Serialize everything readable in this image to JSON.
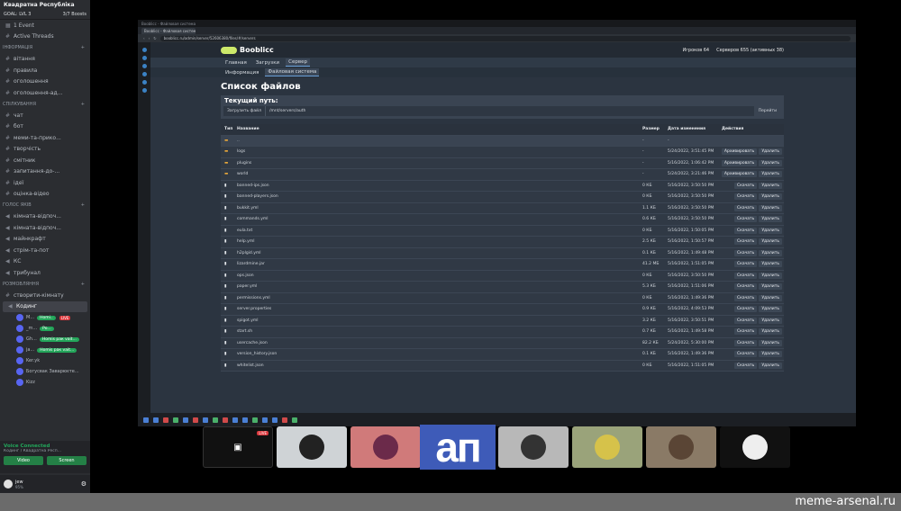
{
  "discord": {
    "server_name": "Квадратна Республіка",
    "goal": "GOAL: LVL 3",
    "boosts": "3/7 Boosts",
    "events": "1 Event",
    "active_threads": "Active Threads",
    "categories": [
      {
        "name": "ІНФОРМАЦІЯ",
        "channels": [
          "вітання",
          "правила",
          "оголошення",
          "оголошення-ад..."
        ]
      },
      {
        "name": "СПІЛКУВАННЯ",
        "channels": [
          "чат",
          "бот",
          "меми-та-прико...",
          "творчість",
          "смітник",
          "запитання-до-...",
          "ідеї",
          "оцінка-відео"
        ]
      },
      {
        "name": "ГОЛОС ЯКІВ",
        "channels": [
          "кімната-відпоч...",
          "кімната-відпоч...",
          "майнкрафт",
          "стрім-та-пот",
          "КС",
          "трибунал"
        ]
      },
      {
        "name": "РОЗМОВЛЯННЯ",
        "channels": [
          "створити-кімнату"
        ]
      }
    ],
    "active_voice": "Кодинг",
    "voice_users": [
      {
        "name": "M...",
        "badge": "Homi..",
        "live": "LIVE"
      },
      {
        "name": "_m...",
        "badge": "Po..."
      },
      {
        "name": "Gh...",
        "badge": "Homis рак vait..."
      },
      {
        "name": "ja...",
        "badge": "Homis рак vait..."
      },
      {
        "name": "Ker.yk"
      },
      {
        "name": "Богусвак Заварюєте..."
      },
      {
        "name": "Kizz"
      }
    ],
    "voice_connected": "Voice Connected",
    "voice_sub": "Кодинг / Квадратна Респ...",
    "video_btn": "Video",
    "screen_btn": "Screen",
    "user_name": "jew",
    "user_status": "95%"
  },
  "browser": {
    "tab_title": "Booblicc - Файловая система",
    "url": "booblicc.ru/admin/server/52606380/files/#/servers"
  },
  "panel": {
    "logo": "Booblicc",
    "players": "Игроков 64",
    "servers": "Серверов 655 (активных 38)",
    "nav1": [
      "Главная",
      "Загрузки",
      "Сервер"
    ],
    "nav2": [
      "Информация",
      "Файловая система"
    ],
    "title": "Список файлов",
    "current_path_label": "Текущий путь:",
    "upload": "Загрузить файл",
    "path": "/mnt/servers/auth",
    "go": "Перейти",
    "headers": [
      "Тип",
      "Название",
      "Размер",
      "Дата изменения",
      "Действия"
    ],
    "rows": [
      {
        "name": "..",
        "size": "-",
        "date": "-",
        "type": "folder",
        "actions": []
      },
      {
        "name": "logs",
        "size": "-",
        "date": "5/24/2022, 3:51:45 PM",
        "type": "folder",
        "actions": [
          "Архивировать",
          "Удалить"
        ]
      },
      {
        "name": "plugins",
        "size": "-",
        "date": "5/16/2022, 1:06:42 PM",
        "type": "folder",
        "actions": [
          "Архивировать",
          "Удалить"
        ]
      },
      {
        "name": "world",
        "size": "-",
        "date": "5/24/2022, 3:21:46 PM",
        "type": "folder",
        "actions": [
          "Архивировать",
          "Удалить"
        ]
      },
      {
        "name": "banned-ips.json",
        "size": "0 КБ",
        "date": "5/16/2022, 3:50:50 PM",
        "type": "file",
        "actions": [
          "Скачать",
          "Удалить"
        ]
      },
      {
        "name": "banned-players.json",
        "size": "0 КБ",
        "date": "5/16/2022, 3:50:50 PM",
        "type": "file",
        "actions": [
          "Скачать",
          "Удалить"
        ]
      },
      {
        "name": "bukkit.yml",
        "size": "1.1 КБ",
        "date": "5/16/2022, 3:50:50 PM",
        "type": "file",
        "actions": [
          "Скачать",
          "Удалить"
        ]
      },
      {
        "name": "commands.yml",
        "size": "0.6 КБ",
        "date": "5/16/2022, 3:50:50 PM",
        "type": "file",
        "actions": [
          "Скачать",
          "Удалить"
        ]
      },
      {
        "name": "eula.txt",
        "size": "0 КБ",
        "date": "5/16/2022, 1:50:05 PM",
        "type": "file",
        "actions": [
          "Скачать",
          "Удалить"
        ]
      },
      {
        "name": "help.yml",
        "size": "2.5 КБ",
        "date": "5/16/2022, 1:50:57 PM",
        "type": "file",
        "actions": [
          "Скачать",
          "Удалить"
        ]
      },
      {
        "name": "h2plgid.yml",
        "size": "0.1 КБ",
        "date": "5/16/2022, 1:49:48 PM",
        "type": "file",
        "actions": [
          "Скачать",
          "Удалить"
        ]
      },
      {
        "name": "lizardmine.jar",
        "size": "41.2 МБ",
        "date": "5/16/2022, 1:51:05 PM",
        "type": "file",
        "actions": [
          "Скачать",
          "Удалить"
        ]
      },
      {
        "name": "ops.json",
        "size": "0 КБ",
        "date": "5/16/2022, 3:50:50 PM",
        "type": "file",
        "actions": [
          "Скачать",
          "Удалить"
        ]
      },
      {
        "name": "paper.yml",
        "size": "5.3 КБ",
        "date": "5/16/2022, 1:51:06 PM",
        "type": "file",
        "actions": [
          "Скачать",
          "Удалить"
        ]
      },
      {
        "name": "permissions.yml",
        "size": "0 КБ",
        "date": "5/16/2022, 1:49:36 PM",
        "type": "file",
        "actions": [
          "Скачать",
          "Удалить"
        ]
      },
      {
        "name": "server.properties",
        "size": "0.9 КБ",
        "date": "5/16/2022, 4:09:53 PM",
        "type": "file",
        "actions": [
          "Скачать",
          "Удалить"
        ]
      },
      {
        "name": "spigot.yml",
        "size": "3.2 КБ",
        "date": "5/16/2022, 3:50:51 PM",
        "type": "file",
        "actions": [
          "Скачать",
          "Удалить"
        ]
      },
      {
        "name": "start.sh",
        "size": "0.7 КБ",
        "date": "5/16/2022, 1:49:58 PM",
        "type": "file",
        "actions": [
          "Скачать",
          "Удалить"
        ]
      },
      {
        "name": "usercache.json",
        "size": "82.2 КБ",
        "date": "5/24/2022, 5:30:00 PM",
        "type": "file",
        "actions": [
          "Скачать",
          "Удалить"
        ]
      },
      {
        "name": "version_history.json",
        "size": "0.1 КБ",
        "date": "5/16/2022, 1:49:36 PM",
        "type": "file",
        "actions": [
          "Скачать",
          "Удалить"
        ]
      },
      {
        "name": "whitelist.json",
        "size": "0 КБ",
        "date": "5/16/2022, 1:51:05 PM",
        "type": "file",
        "actions": [
          "Скачать",
          "Удалить"
        ]
      }
    ]
  },
  "caption": "ап",
  "watermark": "meme-arsenal.ru",
  "live_label": "LIVE"
}
